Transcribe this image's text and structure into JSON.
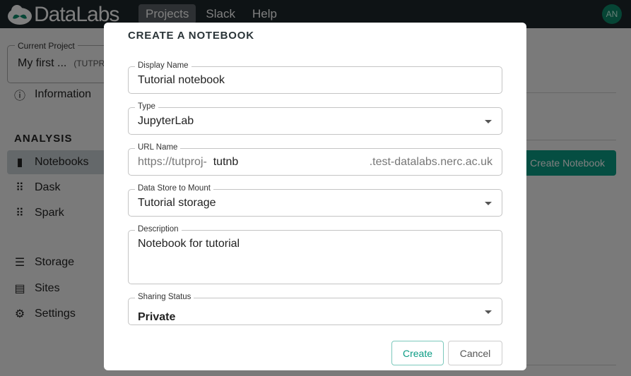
{
  "app": {
    "name": "DataLabs",
    "nav": [
      "Projects",
      "Slack",
      "Help"
    ],
    "avatar": "AN"
  },
  "sidebar": {
    "project_label": "Current Project",
    "project_name": "My first ...",
    "project_key": "(TUTPR",
    "information": "Information",
    "section": "ANALYSIS",
    "items": [
      {
        "label": "Notebooks"
      },
      {
        "label": "Dask"
      },
      {
        "label": "Spark"
      },
      {
        "label": "Storage"
      },
      {
        "label": "Sites"
      },
      {
        "label": "Settings"
      }
    ]
  },
  "page": {
    "create_button": "Create Notebook"
  },
  "dialog": {
    "title": "CREATE A NOTEBOOK",
    "display_name": {
      "label": "Display Name",
      "value": "Tutorial notebook"
    },
    "type": {
      "label": "Type",
      "value": "JupyterLab"
    },
    "url_name": {
      "label": "URL Name",
      "prefix": "https://tutproj-",
      "value": "tutnb",
      "suffix": ".test-datalabs.nerc.ac.uk"
    },
    "data_store": {
      "label": "Data Store to Mount",
      "value": "Tutorial storage"
    },
    "description": {
      "label": "Description",
      "value": "Notebook for tutorial"
    },
    "sharing": {
      "label": "Sharing Status",
      "value": "Private"
    },
    "create": "Create",
    "cancel": "Cancel"
  },
  "colors": {
    "accent": "#0b9c84",
    "topbar": "#1d262b"
  }
}
